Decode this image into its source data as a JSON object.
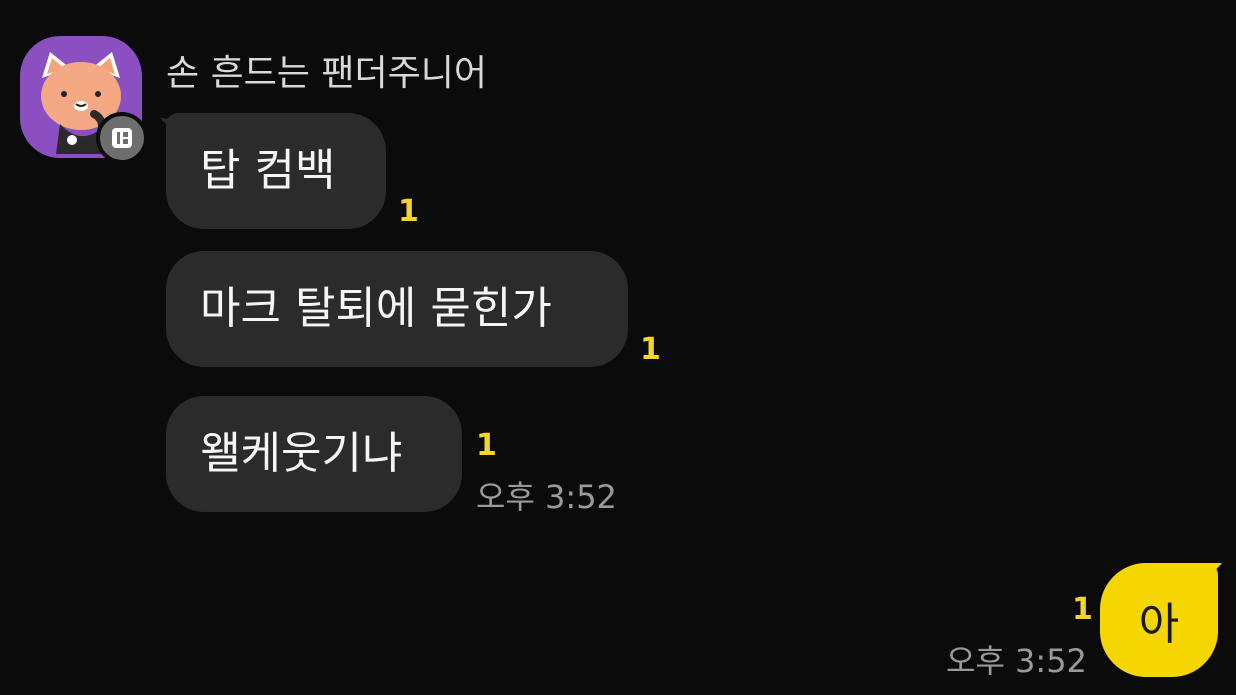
{
  "conversation": {
    "sender": {
      "name": "손 흔드는 팬더주니어",
      "avatar_icon": "cartoon-cat-avatar-icon",
      "badge_icon": "profile-badge-icon"
    },
    "incoming_messages": [
      {
        "text": "탑 컴백",
        "unread": "1"
      },
      {
        "text": "마크 탈퇴에 묻힌가",
        "unread": "1"
      },
      {
        "text": "왤케웃기냐",
        "unread": "1",
        "time": "오후 3:52"
      }
    ],
    "outgoing_messages": [
      {
        "text": "아",
        "unread": "1",
        "time": "오후 3:52"
      }
    ]
  },
  "colors": {
    "background": "#0b0b0b",
    "incoming_bubble": "#2b2b2b",
    "outgoing_bubble": "#f5d600",
    "unread_count": "#f6d52b",
    "timestamp": "#9a9a9a",
    "avatar_bg": "#8b4fc2"
  }
}
